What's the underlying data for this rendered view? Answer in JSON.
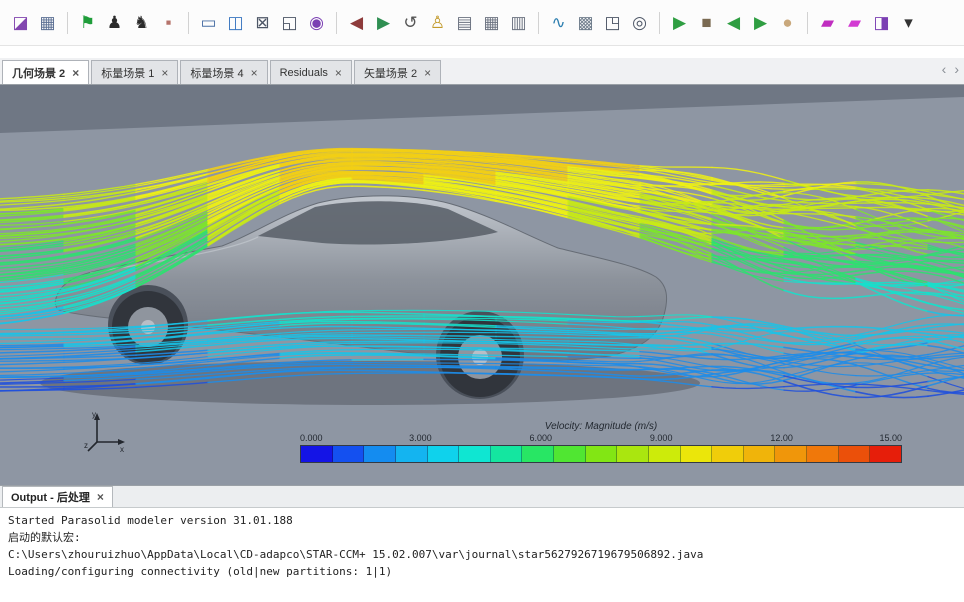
{
  "toolbar": {
    "icons": [
      {
        "name": "open-simulation-icon",
        "glyph": "◪",
        "color": "#8246af"
      },
      {
        "name": "spreadsheet-icon",
        "glyph": "▦",
        "color": "#5b6f93"
      },
      {
        "name": "separator"
      },
      {
        "name": "run-flag-icon",
        "glyph": "⚑",
        "color": "#1f9d3a"
      },
      {
        "name": "walk-solver-icon",
        "glyph": "♟",
        "color": "#2b2b2b"
      },
      {
        "name": "run-solver-icon",
        "glyph": "♞",
        "color": "#2b2b2b"
      },
      {
        "name": "stop-solver-icon",
        "glyph": "▪",
        "color": "#b5736b"
      },
      {
        "name": "separator"
      },
      {
        "name": "notes-icon",
        "glyph": "▭",
        "color": "#4a6fa5"
      },
      {
        "name": "new-window-icon",
        "glyph": "◫",
        "color": "#3a76c0"
      },
      {
        "name": "close-scene-icon",
        "glyph": "⊠",
        "color": "#4d5666"
      },
      {
        "name": "export-view-icon",
        "glyph": "◱",
        "color": "#4d5666"
      },
      {
        "name": "snapshot-icon",
        "glyph": "◉",
        "color": "#7b3fb3"
      },
      {
        "name": "separator"
      },
      {
        "name": "view-back-icon",
        "glyph": "◀",
        "color": "#8e3b3b"
      },
      {
        "name": "view-forward-icon",
        "glyph": "▶",
        "color": "#2f8f52"
      },
      {
        "name": "reset-view-icon",
        "glyph": "↺",
        "color": "#555555"
      },
      {
        "name": "probe-tool-icon",
        "glyph": "♙",
        "color": "#c29a2a"
      },
      {
        "name": "ruler-icon",
        "glyph": "▤",
        "color": "#6b7280"
      },
      {
        "name": "grid-table-icon",
        "glyph": "▦",
        "color": "#6b7280"
      },
      {
        "name": "grid-cells-icon",
        "glyph": "▥",
        "color": "#6b7280"
      },
      {
        "name": "separator"
      },
      {
        "name": "plot-monitor-icon",
        "glyph": "∿",
        "color": "#2e7fb0"
      },
      {
        "name": "scene-image-icon",
        "glyph": "▩",
        "color": "#6f7d8c"
      },
      {
        "name": "export-scene-icon",
        "glyph": "◳",
        "color": "#4d5666"
      },
      {
        "name": "zoom-select-icon",
        "glyph": "◎",
        "color": "#4d5666"
      },
      {
        "name": "separator"
      },
      {
        "name": "play-animation-icon",
        "glyph": "▶",
        "color": "#2f9e42"
      },
      {
        "name": "stop-animation-icon",
        "glyph": "■",
        "color": "#7a6a52"
      },
      {
        "name": "step-back-icon",
        "glyph": "◀",
        "color": "#2f9e42"
      },
      {
        "name": "step-forward-icon",
        "glyph": "▶",
        "color": "#2f9e42"
      },
      {
        "name": "record-icon",
        "glyph": "●",
        "color": "#c9a87c"
      },
      {
        "name": "separator"
      },
      {
        "name": "new-scalar-scene-icon",
        "glyph": "▰",
        "color": "#c02ec0"
      },
      {
        "name": "new-vector-scene-icon",
        "glyph": "▰",
        "color": "#d23bd2"
      },
      {
        "name": "new-geometry-scene-icon",
        "glyph": "◨",
        "color": "#7b3fb3"
      },
      {
        "name": "scene-menu-dropdown-icon",
        "glyph": "▾",
        "color": "#333333"
      }
    ]
  },
  "tabs": {
    "items": [
      {
        "label": "几何场景 2",
        "active": true
      },
      {
        "label": "标量场景 1",
        "active": false
      },
      {
        "label": "标量场景 4",
        "active": false
      },
      {
        "label": "Residuals",
        "active": false
      },
      {
        "label": "矢量场景 2",
        "active": false
      }
    ],
    "close_glyph": "×",
    "scroll_left_glyph": "‹",
    "scroll_right_glyph": "›"
  },
  "viewport": {
    "background": "#8e96a3",
    "triad": {
      "x_label": "x",
      "y_label": "y",
      "z_label": "z"
    },
    "colorbar": {
      "title": "Velocity: Magnitude (m/s)",
      "ticks": [
        "0.000",
        "3.000",
        "6.000",
        "9.000",
        "12.00",
        "15.00"
      ],
      "colors": [
        "#1414e6",
        "#1450f0",
        "#148cf0",
        "#14b4f0",
        "#0fd2ec",
        "#0fe6d2",
        "#14e6a0",
        "#28e664",
        "#50e632",
        "#82e614",
        "#aae60f",
        "#cdeb0a",
        "#ebe60a",
        "#f0cd0a",
        "#f0b40a",
        "#f0960a",
        "#f0780a",
        "#eb500a",
        "#e61e0a"
      ]
    },
    "streamline_palette": [
      "#2050dc",
      "#1e8ce8",
      "#18c4e8",
      "#16e0cc",
      "#2ee070",
      "#7de62a",
      "#c8ea14",
      "#eef014",
      "#f2cf14"
    ]
  },
  "output": {
    "tab_label": "Output - 后处理",
    "close_glyph": "×",
    "lines": [
      "Started Parasolid modeler version 31.01.188",
      "启动的默认宏:",
      "C:\\Users\\zhouruizhuo\\AppData\\Local\\CD-adapco\\STAR-CCM+ 15.02.007\\var\\journal\\star5627926719679506892.java",
      "Loading/configuring connectivity (old|new partitions: 1|1)"
    ]
  }
}
